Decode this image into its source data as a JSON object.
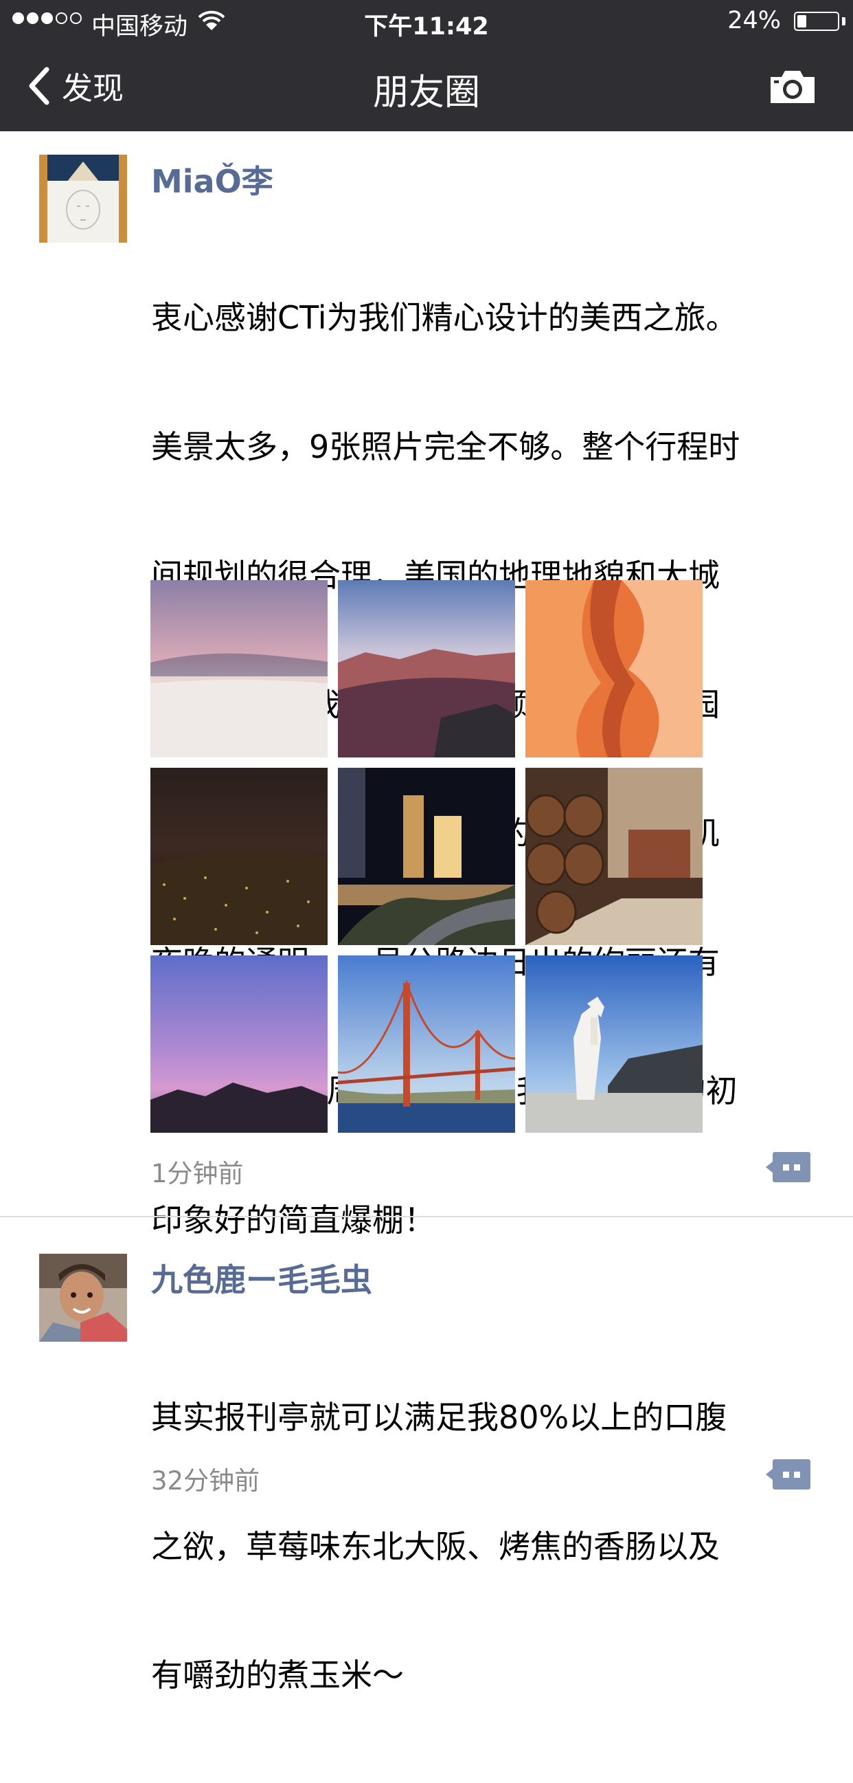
{
  "status_bar": {
    "carrier": "中国移动",
    "time": "下午11:42",
    "battery": "24%",
    "battery_level": 0.24,
    "signal_strength": 3
  },
  "nav": {
    "back_label": "发现",
    "title": "朋友圈"
  },
  "posts": [
    {
      "author": "MiaǑ李",
      "text": "衷心感谢CTi为我们精心设计的美西之旅。美景太多，9张照片完全不够。整个行程时间规划的很合理，美国的地理地貌和大城市的繁华让我们全都一一领略。白沙公园日落的迷人，大峡谷日照的壮美，洛杉矶夜晚的通明，一号公路边日出的绚丽还有导游和CTi的周到服务，让我们对美国的初印象好的简直爆棚！",
      "text_lines": [
        "衷心感谢CTi为我们精心设计的美西之旅。",
        "美景太多，9张照片完全不够。整个行程时",
        "间规划的很合理，美国的地理地貌和大城",
        "市的繁华让我们全都一一领略。白沙公园",
        "日落的迷人，大峡谷日照的壮美，洛杉矶",
        "夜晚的通明，一号公路边日出的绚丽还有",
        "导游和CTi的周到服务，让我们对美国的初",
        "印象好的简直爆棚！"
      ],
      "time": "1分钟前"
    },
    {
      "author": "九色鹿ー毛毛虫",
      "text_lines": [
        "其实报刊亭就可以满足我80%以上的口腹",
        "之欲，草莓味东北大阪、烤焦的香肠以及",
        "有嚼劲的煮玉米～"
      ],
      "time": "32分钟前"
    }
  ],
  "colors": {
    "nav_bg": "#2e2e33",
    "name_link": "#576b95",
    "time_gray": "#8a8a8a",
    "comment_btn": "#8193b5"
  }
}
